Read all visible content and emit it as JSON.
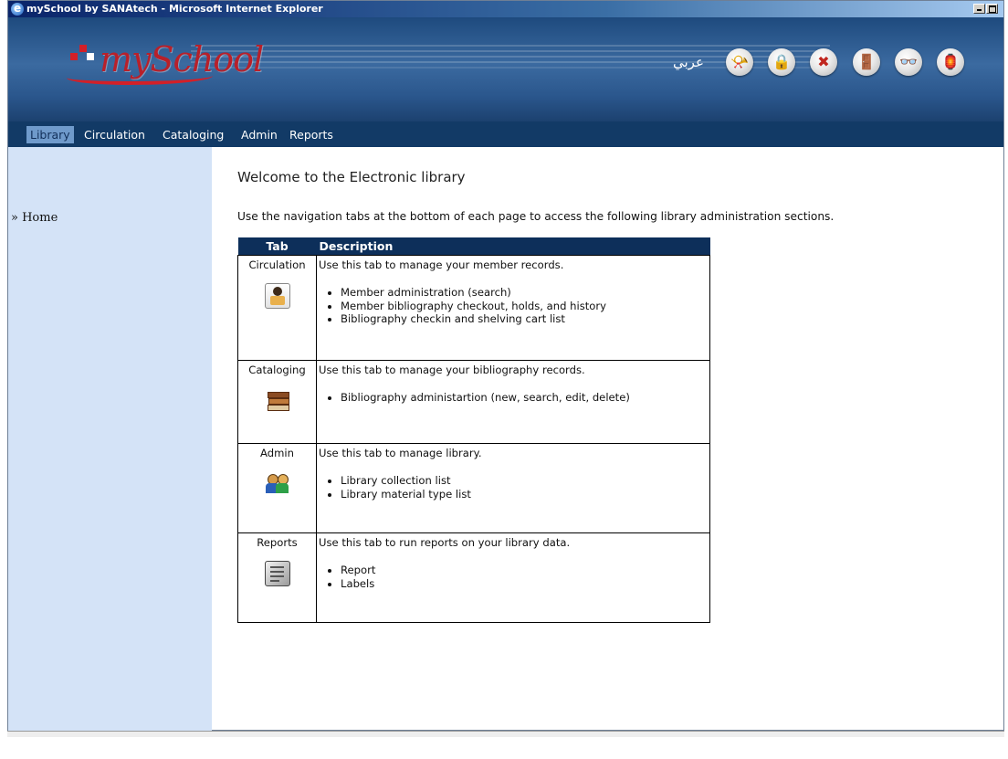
{
  "window": {
    "title": "mySchool by SANAtech - Microsoft Internet Explorer"
  },
  "header": {
    "logo_text": "mySchool",
    "lang_label": "عربي",
    "icons": [
      "horn-icon",
      "lock-icon",
      "cancel-icon",
      "exit-door-icon",
      "glasses-icon",
      "lantern-icon"
    ]
  },
  "nav": {
    "tabs": [
      "Library",
      "Circulation",
      "Cataloging",
      "Admin",
      "Reports"
    ],
    "active": "Library"
  },
  "sidebar": {
    "home": "» Home"
  },
  "main": {
    "heading": "Welcome to the Electronic library",
    "intro": "Use the navigation tabs at the bottom of each page to access the following library administration sections.",
    "table": {
      "headers": [
        "Tab",
        "Description"
      ],
      "rows": [
        {
          "tab": "Circulation",
          "icon": "reader-icon",
          "desc": "Use this tab to manage your member records.",
          "items": [
            "Member administration (search)",
            "Member bibliography checkout, holds, and history",
            "Bibliography checkin and shelving cart list"
          ]
        },
        {
          "tab": "Cataloging",
          "icon": "books-icon",
          "desc": "Use this tab to manage your bibliography records.",
          "items": [
            "Bibliography administartion (new, search, edit, delete)"
          ]
        },
        {
          "tab": "Admin",
          "icon": "users-icon",
          "desc": "Use this tab to manage library.",
          "items": [
            "Library collection list",
            "Library material type list"
          ]
        },
        {
          "tab": "Reports",
          "icon": "report-icon",
          "desc": "Use this tab to run reports on your library data.",
          "items": [
            "Report",
            "Labels"
          ]
        }
      ]
    }
  },
  "colors": {
    "header_blue": "#2b578d",
    "tabbar": "#123a66",
    "active_tab": "#6f9acb",
    "sidebar": "#d4e3f7",
    "table_head": "#0d2f5a",
    "logo_red": "#b8202a"
  }
}
